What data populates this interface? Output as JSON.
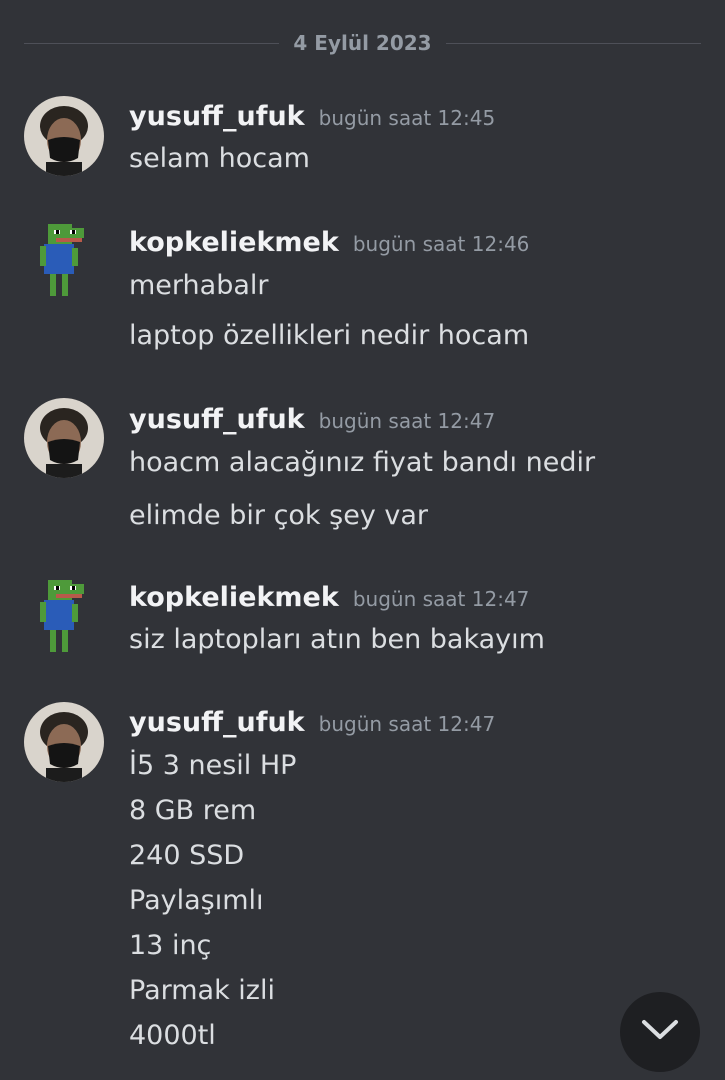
{
  "date_divider": "4 Eylül 2023",
  "messages": [
    {
      "user": "yusuff_ufuk",
      "time": "bugün saat 12:45",
      "lines": [
        "selam hocam"
      ]
    },
    {
      "user": "kopkeliekmek",
      "time": "bugün saat 12:46",
      "lines": [
        "merhabalr",
        "laptop özellikleri nedir hocam"
      ]
    },
    {
      "user": "yusuff_ufuk",
      "time": "bugün saat 12:47",
      "lines": [
        "hoacm alacağınız fiyat bandı nedir",
        "elimde bir çok şey var"
      ]
    },
    {
      "user": "kopkeliekmek",
      "time": "bugün saat 12:47",
      "lines": [
        "siz laptopları atın ben bakayım"
      ]
    },
    {
      "user": "yusuff_ufuk",
      "time": "bugün saat 12:47",
      "lines": [
        "İ5 3 nesil HP",
        "8 GB rem",
        "240 SSD",
        "Paylaşımlı",
        "13 inç",
        "Parmak izli",
        "4000tl"
      ]
    }
  ],
  "icons": {
    "scroll_down": "chevron-down-icon"
  },
  "colors": {
    "background": "#313338",
    "username": "#f2f3f5",
    "timestamp": "#949ba4",
    "text": "#dbdee1"
  }
}
